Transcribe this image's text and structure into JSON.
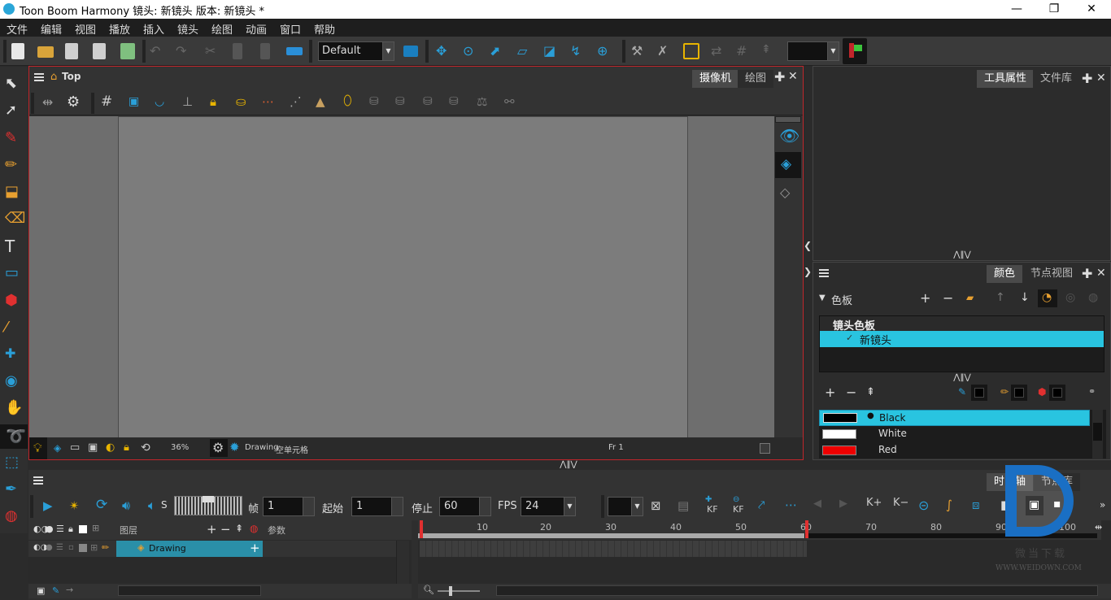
{
  "window": {
    "title": "Toon Boom Harmony 镜头: 新镜头 版本: 新镜头 *",
    "minimize": "—",
    "maximize": "❐",
    "close": "✕"
  },
  "menu": [
    "文件",
    "编辑",
    "视图",
    "播放",
    "插入",
    "镜头",
    "绘图",
    "动画",
    "窗口",
    "帮助"
  ],
  "toolbar": {
    "workspace_select": "Default"
  },
  "camera_view": {
    "breadcrumb": "Top",
    "tabs": [
      "摄像机",
      "绘图"
    ],
    "zoom": "36%",
    "drawing_label": "Drawing",
    "drawing_status": "空单元格",
    "frame": "Fr 1"
  },
  "tool_properties": {
    "tabs": [
      "工具属性",
      "文件库"
    ]
  },
  "color_panel": {
    "tabs": [
      "颜色",
      "节点视图"
    ],
    "palette_header": "色板",
    "palette_list_title": "镜头色板",
    "palettes": [
      {
        "name": "新镜头",
        "check": "✓"
      }
    ],
    "swatches": [
      {
        "name": "Black",
        "color": "#000000",
        "dot": "●"
      },
      {
        "name": "White",
        "color": "#ffffff",
        "dot": ""
      },
      {
        "name": "Red",
        "color": "#ee0000",
        "dot": ""
      }
    ]
  },
  "timeline": {
    "tabs": [
      "时间轴",
      "节点库"
    ],
    "frame_label": "帧",
    "frame_value": "1",
    "start_label": "起始",
    "start_value": "1",
    "stop_label": "停止",
    "stop_value": "60",
    "fps_label": "FPS",
    "fps_value": "24",
    "layers_label": "图层",
    "params_label": "参数",
    "layer_name": "Drawing",
    "ticks": [
      "10",
      "20",
      "30",
      "40",
      "50",
      "60",
      "70",
      "80",
      "90",
      "100"
    ],
    "kf1": "KF",
    "kf2": "KF",
    "s_label": "S"
  },
  "watermark": {
    "text": "WWW.WEIDOWN.COM",
    "cn": "微当下载"
  },
  "colors": {
    "accent": "#29b9d8",
    "red_border": "#c0262b"
  }
}
